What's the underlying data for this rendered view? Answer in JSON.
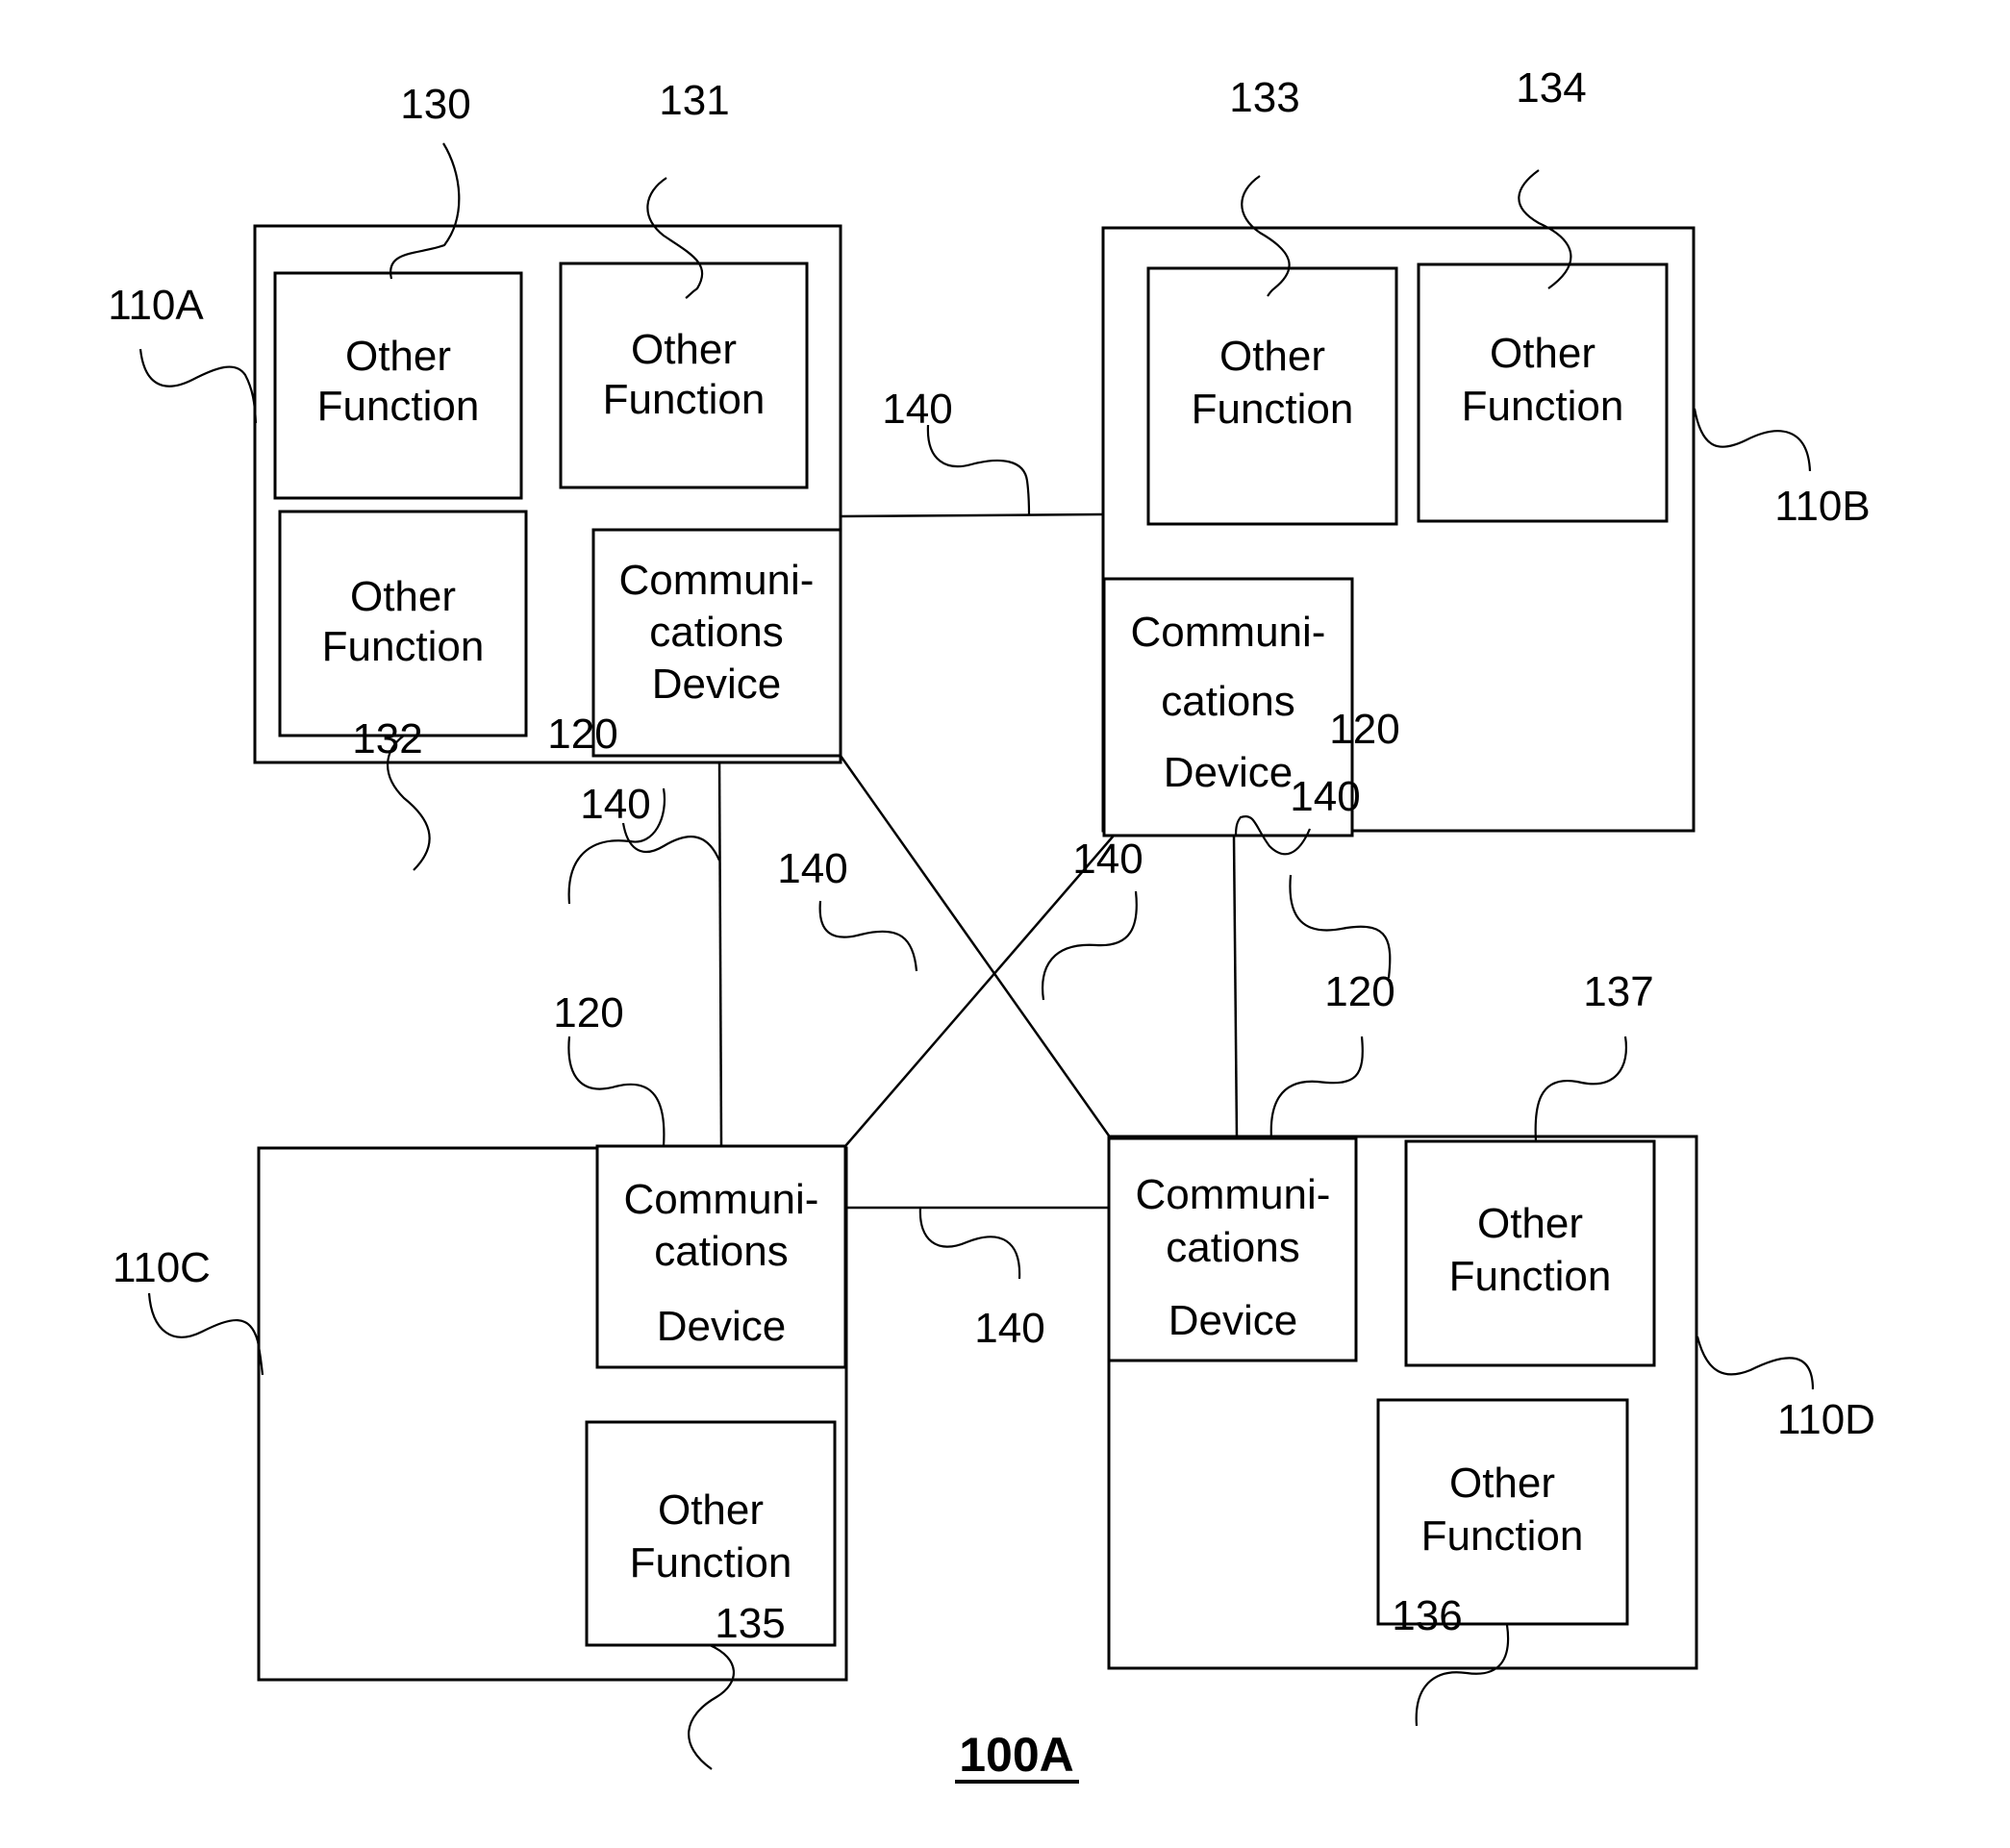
{
  "figure": {
    "label": "100A"
  },
  "nodes": [
    {
      "ref": "110A",
      "comm_ref": "120",
      "comm_label": [
        "Communi-",
        "cations",
        "Device"
      ],
      "functions": [
        {
          "ref": "130",
          "label": [
            "Other",
            "Function"
          ]
        },
        {
          "ref": "131",
          "label": [
            "Other",
            "Function"
          ]
        },
        {
          "ref": "132",
          "label": [
            "Other",
            "Function"
          ]
        }
      ]
    },
    {
      "ref": "110B",
      "comm_ref": "120",
      "comm_label": [
        "Communi-",
        "cations",
        "Device"
      ],
      "functions": [
        {
          "ref": "133",
          "label": [
            "Other",
            "Function"
          ]
        },
        {
          "ref": "134",
          "label": [
            "Other",
            "Function"
          ]
        }
      ]
    },
    {
      "ref": "110C",
      "comm_ref": "120",
      "comm_label": [
        "Communi-",
        "cations",
        "Device"
      ],
      "functions": [
        {
          "ref": "135",
          "label": [
            "Other",
            "Function"
          ]
        }
      ]
    },
    {
      "ref": "110D",
      "comm_ref": "120",
      "comm_label": [
        "Communi-",
        "cations",
        "Device"
      ],
      "functions": [
        {
          "ref": "136",
          "label": [
            "Other",
            "Function"
          ]
        },
        {
          "ref": "137",
          "label": [
            "Other",
            "Function"
          ]
        }
      ]
    }
  ],
  "links": {
    "ref": "140",
    "connections": [
      {
        "from": "110A",
        "to": "110B"
      },
      {
        "from": "110A",
        "to": "110C"
      },
      {
        "from": "110A",
        "to": "110D"
      },
      {
        "from": "110B",
        "to": "110C"
      },
      {
        "from": "110B",
        "to": "110D"
      },
      {
        "from": "110C",
        "to": "110D"
      }
    ]
  }
}
